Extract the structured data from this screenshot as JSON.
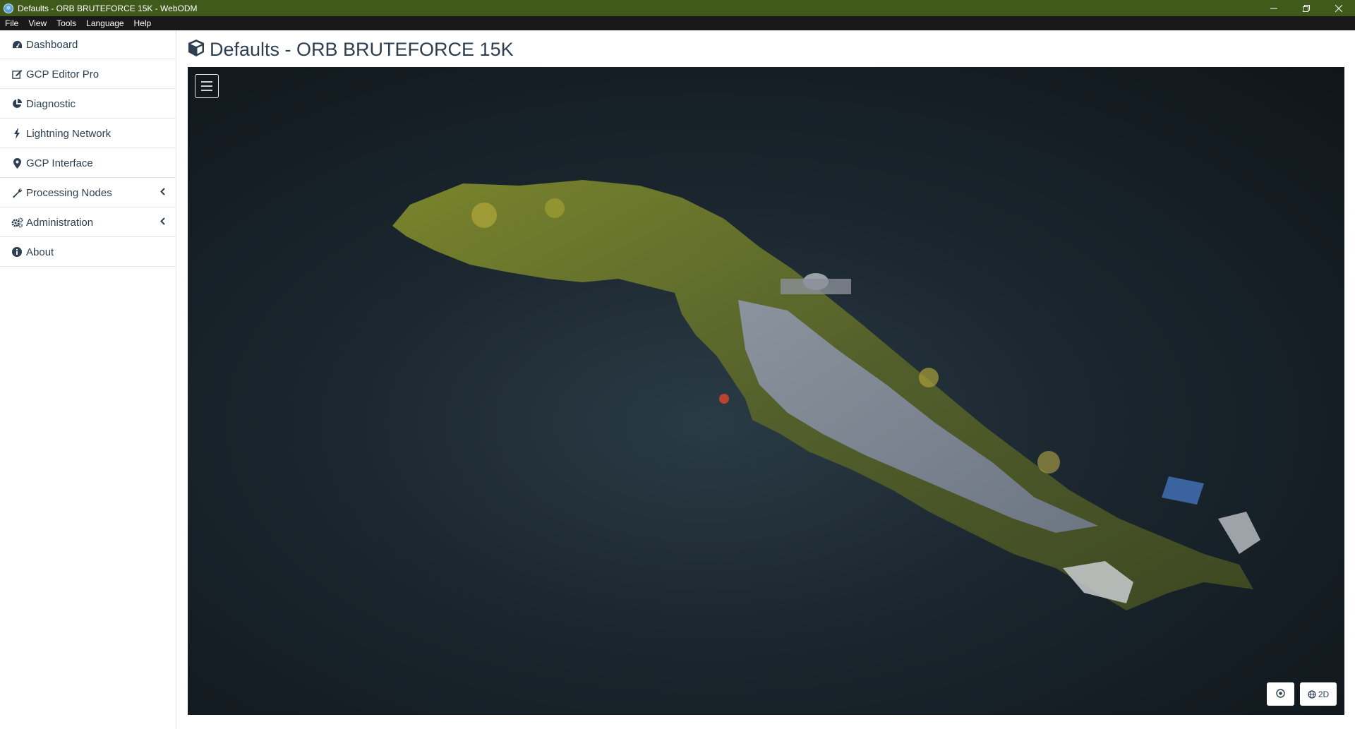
{
  "window": {
    "title": "Defaults - ORB BRUTEFORCE 15K - WebODM",
    "controls": [
      "minimize-icon",
      "restore-icon",
      "close-icon"
    ]
  },
  "menu": {
    "items": [
      "File",
      "View",
      "Tools",
      "Language",
      "Help"
    ]
  },
  "sidebar": {
    "items": [
      {
        "label": "Dashboard",
        "icon": "dashboard-icon"
      },
      {
        "label": "GCP Editor Pro",
        "icon": "gcp-editor-icon"
      },
      {
        "label": "Diagnostic",
        "icon": "pie-chart-icon"
      },
      {
        "label": "Lightning Network",
        "icon": "bolt-icon"
      },
      {
        "label": "GCP Interface",
        "icon": "map-marker-icon"
      },
      {
        "label": "Processing Nodes",
        "icon": "wrench-icon",
        "expandable": true
      },
      {
        "label": "Administration",
        "icon": "cogs-icon",
        "expandable": true
      },
      {
        "label": "About",
        "icon": "info-icon"
      }
    ]
  },
  "page": {
    "title": "Defaults - ORB BRUTEFORCE 15K",
    "icon": "cube-icon"
  },
  "viewer": {
    "toggle_icon": "hamburger-icon",
    "controls": {
      "reset_icon": "target-icon",
      "mode_label": "2D",
      "mode_icon": "globe-icon"
    }
  },
  "colors": {
    "titlebar": "#3f5a1b",
    "menubar": "#191919",
    "text": "#2c3e50",
    "viewer_bg": "#1a252d"
  }
}
